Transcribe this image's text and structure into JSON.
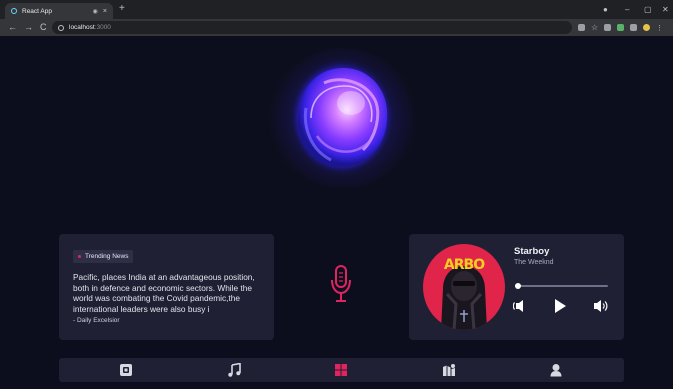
{
  "browser": {
    "tab_title": "React App",
    "tab_close": "×",
    "new_tab": "+",
    "back": "←",
    "forward": "→",
    "reload": "C",
    "url_host": "localhost",
    "url_port": ":3000",
    "window_minimize": "–",
    "window_restore": "▢",
    "window_close": "✕",
    "menu": "⋮"
  },
  "news": {
    "badge": "Trending News",
    "text": "Pacific, places India at an advantageous position, both in defence and economic sectors. While the world was combating the Covid pandemic,the international leaders were also busy i",
    "source": "- Daily Excelsior"
  },
  "player": {
    "album_text": "ARBO",
    "track_title": "Starboy",
    "artist": "The Weeknd",
    "progress": 0.02
  },
  "colors": {
    "background": "#0d0e1d",
    "card": "#1f2034",
    "accent": "#e0245e",
    "nav_icon": "#d8d8e0"
  },
  "nav": {
    "items": [
      {
        "icon": "news-icon",
        "active": false
      },
      {
        "icon": "music-icon",
        "active": false
      },
      {
        "icon": "dashboard-icon",
        "active": true
      },
      {
        "icon": "map-icon",
        "active": false
      },
      {
        "icon": "profile-icon",
        "active": false
      }
    ]
  }
}
